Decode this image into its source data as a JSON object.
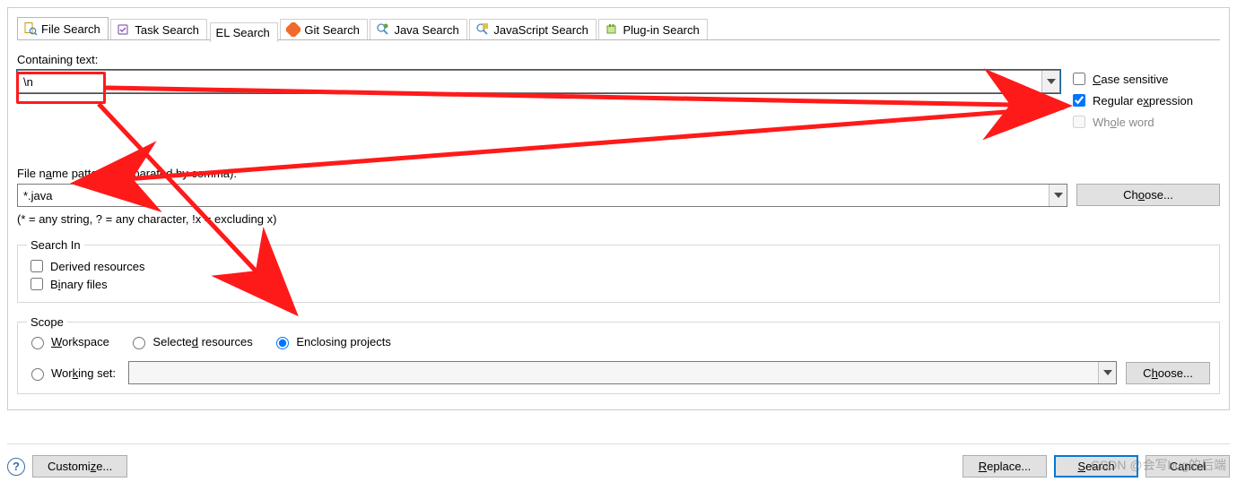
{
  "tabs": [
    {
      "label": "File Search",
      "icon": "file-search"
    },
    {
      "label": "Task Search",
      "icon": "task-search"
    },
    {
      "label": "EL Search",
      "icon": ""
    },
    {
      "label": "Git Search",
      "icon": "git-search"
    },
    {
      "label": "Java Search",
      "icon": "java-search"
    },
    {
      "label": "JavaScript Search",
      "icon": "js-search"
    },
    {
      "label": "Plug-in Search",
      "icon": "plugin-search"
    }
  ],
  "containing": {
    "label": "Containing text:",
    "value": "\\n"
  },
  "options": {
    "case_sensitive": "Case sensitive",
    "regex": "Regular expression",
    "whole_word": "Whole word"
  },
  "filename": {
    "label": "File name patterns (separated by comma):",
    "value": "*.java",
    "choose": "Choose...",
    "hint": "(* = any string, ? = any character, !x = excluding x)"
  },
  "search_in": {
    "legend": "Search In",
    "derived": "Derived resources",
    "binary": "Binary files"
  },
  "scope": {
    "legend": "Scope",
    "workspace": "Workspace",
    "selected": "Selected resources",
    "enclosing": "Enclosing projects",
    "working_set": "Working set:",
    "choose": "Choose..."
  },
  "footer": {
    "customize": "Customize...",
    "replace": "Replace...",
    "search": "Search",
    "cancel": "Cancel"
  },
  "watermark": "CSDN @会写bug的后端"
}
